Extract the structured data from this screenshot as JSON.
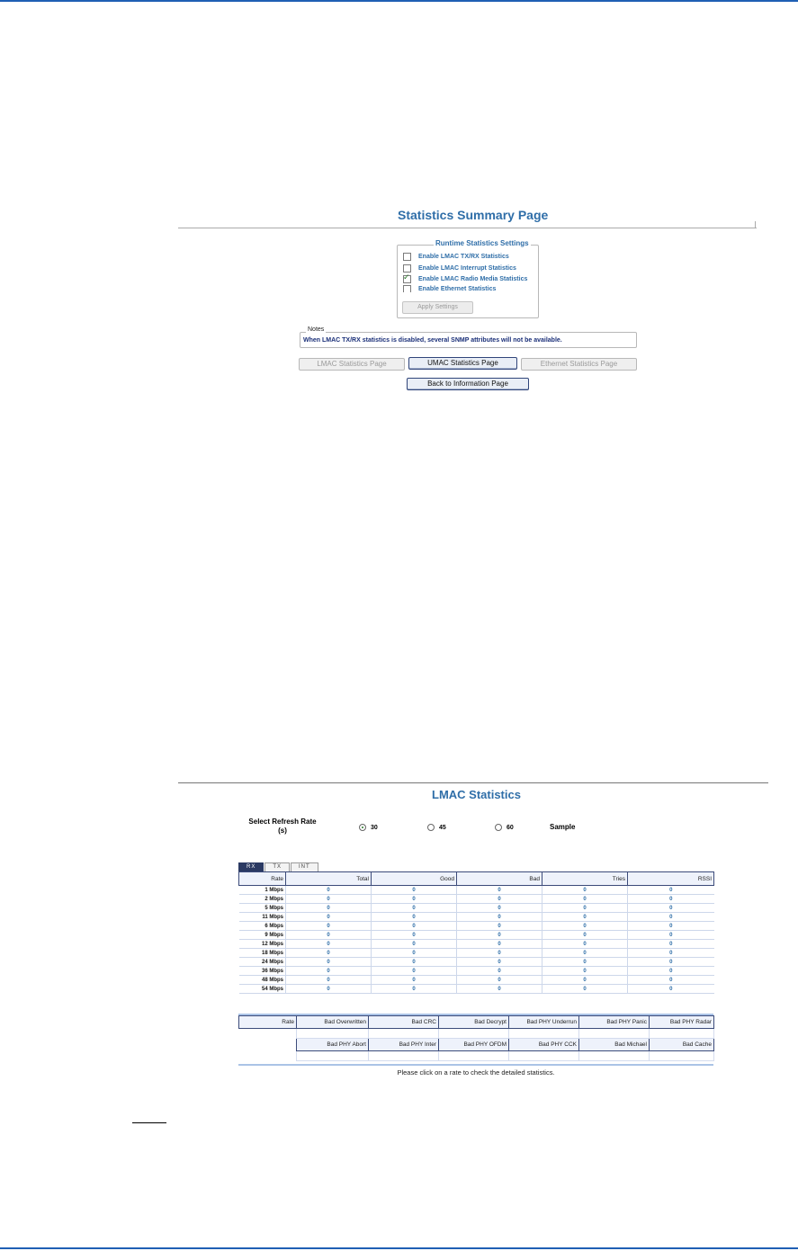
{
  "summary": {
    "title": "Statistics Summary Page",
    "runtime_settings": {
      "legend": "Runtime Statistics Settings",
      "options": [
        {
          "label": "Enable LMAC TX/RX Statistics",
          "checked": false
        },
        {
          "label": "Enable LMAC Interrupt Statistics",
          "checked": false
        },
        {
          "label": "Enable LMAC Radio Media Statistics",
          "checked": true
        },
        {
          "label": "Enable Ethernet Statistics",
          "checked": false
        }
      ],
      "apply_label": "Apply Settings"
    },
    "notes": {
      "legend": "Notes",
      "text": "When LMAC TX/RX statistics is disabled, several SNMP attributes will not be available."
    },
    "buttons": {
      "lmac": "LMAC Statistics Page",
      "umac": "UMAC Statistics Page",
      "ethernet": "Ethernet Statistics Page",
      "back": "Back to Information Page"
    }
  },
  "lmac": {
    "title": "LMAC Statistics",
    "refresh_label": "Select Refresh Rate (s)",
    "refresh_options": [
      {
        "label": "30",
        "selected": true
      },
      {
        "label": "45",
        "selected": false
      },
      {
        "label": "60",
        "selected": false
      }
    ],
    "sample_label": "Sample",
    "tabs": [
      "RX",
      "TX",
      "INT"
    ],
    "active_tab": "RX",
    "columns": [
      "Rate",
      "Total",
      "Good",
      "Bad",
      "Tries",
      "RSSI"
    ],
    "rows": [
      {
        "rate": "1 Mbps",
        "values": [
          "0",
          "0",
          "0",
          "0",
          "0"
        ]
      },
      {
        "rate": "2 Mbps",
        "values": [
          "0",
          "0",
          "0",
          "0",
          "0"
        ]
      },
      {
        "rate": "5 Mbps",
        "values": [
          "0",
          "0",
          "0",
          "0",
          "0"
        ]
      },
      {
        "rate": "11 Mbps",
        "values": [
          "0",
          "0",
          "0",
          "0",
          "0"
        ]
      },
      {
        "rate": "6 Mbps",
        "values": [
          "0",
          "0",
          "0",
          "0",
          "0"
        ]
      },
      {
        "rate": "9 Mbps",
        "values": [
          "0",
          "0",
          "0",
          "0",
          "0"
        ]
      },
      {
        "rate": "12 Mbps",
        "values": [
          "0",
          "0",
          "0",
          "0",
          "0"
        ]
      },
      {
        "rate": "18 Mbps",
        "values": [
          "0",
          "0",
          "0",
          "0",
          "0"
        ]
      },
      {
        "rate": "24 Mbps",
        "values": [
          "0",
          "0",
          "0",
          "0",
          "0"
        ]
      },
      {
        "rate": "36 Mbps",
        "values": [
          "0",
          "0",
          "0",
          "0",
          "0"
        ]
      },
      {
        "rate": "48 Mbps",
        "values": [
          "0",
          "0",
          "0",
          "0",
          "0"
        ]
      },
      {
        "rate": "54 Mbps",
        "values": [
          "0",
          "0",
          "0",
          "0",
          "0"
        ]
      }
    ],
    "error_rate_label": "Rate",
    "error_columns_1": [
      "Bad Overwritten",
      "Bad CRC",
      "Bad Decrypt",
      "Bad PHY Underrun",
      "Bad PHY Panic",
      "Bad PHY Radar"
    ],
    "error_columns_2": [
      "Bad PHY Abort",
      "Bad PHY Inter",
      "Bad PHY OFDM",
      "Bad PHY CCK",
      "Bad Michael",
      "Bad Cache"
    ],
    "hint": "Please click on a rate to check the detailed statistics."
  },
  "colors": {
    "accent": "#2f6ea8",
    "rule": "#1f5fb4",
    "tab_active": "#2b3a63"
  }
}
